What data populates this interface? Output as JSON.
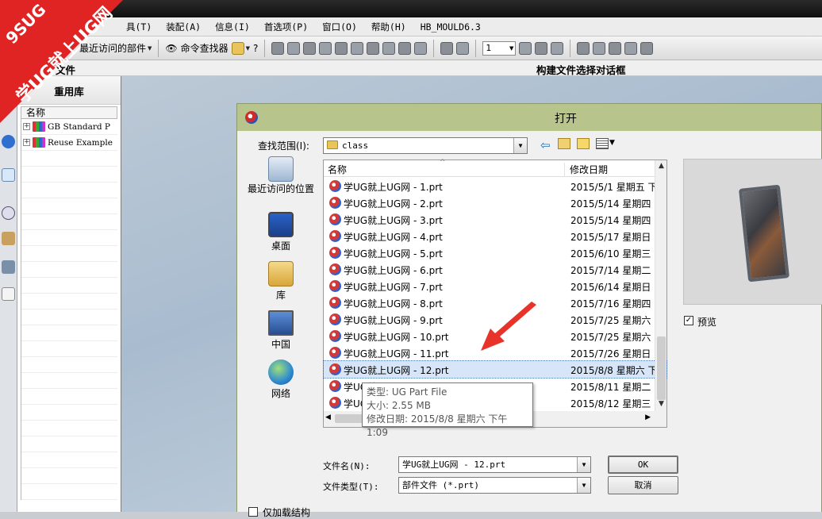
{
  "menubar": {
    "items": [
      "具(T)",
      "装配(A)",
      "信息(I)",
      "首选项(P)",
      "窗口(O)",
      "帮助(H)",
      "HB_MOULD6.3"
    ]
  },
  "toolbar": {
    "recent_parts": "最近访问的部件",
    "command_finder": "命令查找器",
    "layer_value": "1"
  },
  "strip": {
    "left_text": "文件",
    "right_text": "构建文件选择对话框"
  },
  "watermark": {
    "line1": "9SUG",
    "line2": "学UG就上UG网"
  },
  "panel": {
    "title": "重用库",
    "column": "名称",
    "items": [
      "GB Standard P",
      "Reuse Example"
    ]
  },
  "dialog": {
    "title": "打开",
    "look_in_label": "查找范围(I):",
    "look_in_value": "class",
    "places": [
      "最近访问的位置",
      "桌面",
      "库",
      "中国",
      "网络"
    ],
    "columns": {
      "name": "名称",
      "modified": "修改日期"
    },
    "files": [
      {
        "name": "学UG就上UG网 - 1.prt",
        "date": "2015/5/1 星期五 下..."
      },
      {
        "name": "学UG就上UG网 - 2.prt",
        "date": "2015/5/14 星期四 ..."
      },
      {
        "name": "学UG就上UG网 - 3.prt",
        "date": "2015/5/14 星期四 ..."
      },
      {
        "name": "学UG就上UG网 - 4.prt",
        "date": "2015/5/17 星期日 ..."
      },
      {
        "name": "学UG就上UG网 - 5.prt",
        "date": "2015/6/10 星期三 ..."
      },
      {
        "name": "学UG就上UG网 - 6.prt",
        "date": "2015/7/14 星期二 ..."
      },
      {
        "name": "学UG就上UG网 - 7.prt",
        "date": "2015/6/14 星期日 ..."
      },
      {
        "name": "学UG就上UG网 - 8.prt",
        "date": "2015/7/16 星期四 ..."
      },
      {
        "name": "学UG就上UG网 - 9.prt",
        "date": "2015/7/25 星期六 ..."
      },
      {
        "name": "学UG就上UG网 - 10.prt",
        "date": "2015/7/25 星期六 ..."
      },
      {
        "name": "学UG就上UG网 - 11.prt",
        "date": "2015/7/26 星期日 ..."
      },
      {
        "name": "学UG就上UG网 - 12.prt",
        "date": "2015/8/8 星期六 下..."
      },
      {
        "name": "学UG就上UG网 - 13.prt",
        "date": "2015/8/11 星期二 ..."
      },
      {
        "name": "学UG就上UG网 - 14.prt",
        "date": "2015/8/12 星期三 ..."
      }
    ],
    "selected_index": 11,
    "tooltip": {
      "type": "类型: UG Part File",
      "size": "大小: 2.55 MB",
      "modified": "修改日期: 2015/8/8 星期六 下午 1:09"
    },
    "preview_label": "预览",
    "filename_label": "文件名(N):",
    "filename_value": "学UG就上UG网 - 12.prt",
    "filetype_label": "文件类型(T):",
    "filetype_value": "部件文件 (*.prt)",
    "ok_label": "OK",
    "cancel_label": "取消",
    "load_structure_label": "仅加载结构"
  },
  "colors": {
    "dialog_title": "#b7c48c",
    "selection": "#d6e6f8",
    "watermark": "#e02424",
    "arrow": "#e8332a"
  }
}
